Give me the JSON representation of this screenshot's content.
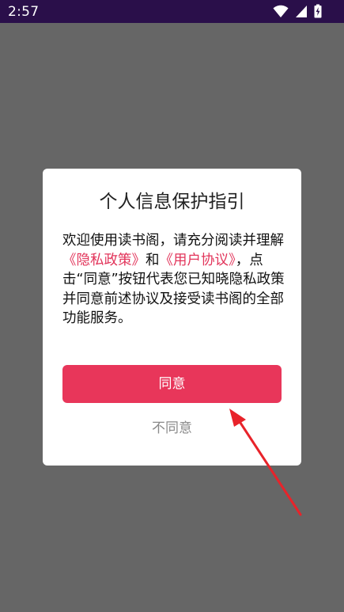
{
  "status_bar": {
    "time": "2:57",
    "icons": [
      "wifi-icon",
      "signal-icon",
      "battery-charging-icon"
    ]
  },
  "dialog": {
    "title": "个人信息保护指引",
    "body_prefix": "欢迎使用读书阁，请充分阅读并理解",
    "privacy_link": "《隐私政策》",
    "connector": "和",
    "agreement_link": "《用户协议》",
    "body_suffix": "，点击“同意”按钮代表您已知晓隐私政策并同意前述协议及接受读书阁的全部功能服务。",
    "agree_label": "同意",
    "disagree_label": "不同意"
  },
  "colors": {
    "status_bar": "#2a0f4a",
    "overlay": "#666666",
    "accent": "#e8365a",
    "link": "#e2345a",
    "annotation_arrow": "#e8232a"
  }
}
